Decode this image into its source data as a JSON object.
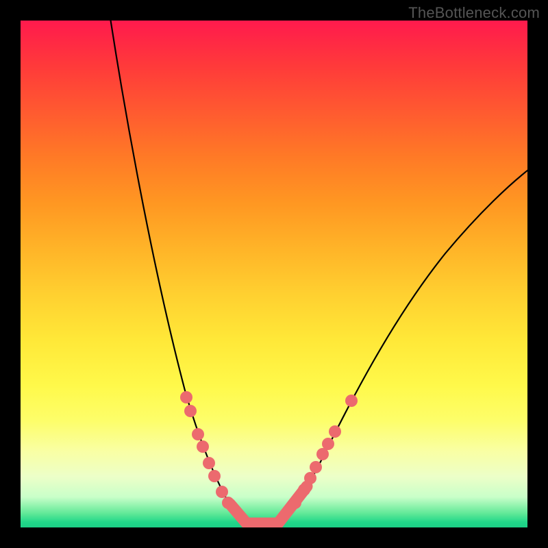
{
  "watermark": "TheBottleneck.com",
  "chart_data": {
    "type": "line",
    "title": "",
    "xlabel": "",
    "ylabel": "",
    "xlim": [
      0,
      100
    ],
    "ylim": [
      0,
      100
    ],
    "grid": false,
    "background_gradient": {
      "direction": "vertical",
      "stops": [
        {
          "pos": 0.0,
          "color": "#ff1a4d"
        },
        {
          "pos": 0.5,
          "color": "#ffd030"
        },
        {
          "pos": 0.8,
          "color": "#fdfe6a"
        },
        {
          "pos": 0.95,
          "color": "#c9ffc9"
        },
        {
          "pos": 1.0,
          "color": "#1dcf86"
        }
      ]
    },
    "series": [
      {
        "name": "bottleneck-curve",
        "color": "#000000",
        "x": [
          18,
          20,
          24,
          28,
          32,
          36,
          40,
          44,
          46,
          50,
          54,
          58,
          62,
          68,
          76,
          84,
          92,
          100
        ],
        "y": [
          100,
          90,
          75,
          62,
          50,
          40,
          30,
          18,
          8,
          0,
          0,
          8,
          18,
          30,
          45,
          58,
          66,
          72
        ]
      }
    ],
    "markers": {
      "name": "sample-points",
      "color": "#ec6a6e",
      "x": [
        33,
        34,
        35,
        36,
        37,
        38,
        40,
        41,
        54,
        56,
        57,
        58,
        60,
        61,
        62,
        65
      ],
      "y": [
        26,
        23,
        19,
        16,
        13,
        10,
        7,
        5,
        5,
        7,
        9,
        11,
        14,
        16,
        19,
        25
      ]
    },
    "highlight_zone": {
      "description": "optimal / zero-bottleneck region at curve minimum",
      "color": "#ec6a6e",
      "x_range": [
        41,
        56
      ],
      "y_approx": 0
    }
  }
}
